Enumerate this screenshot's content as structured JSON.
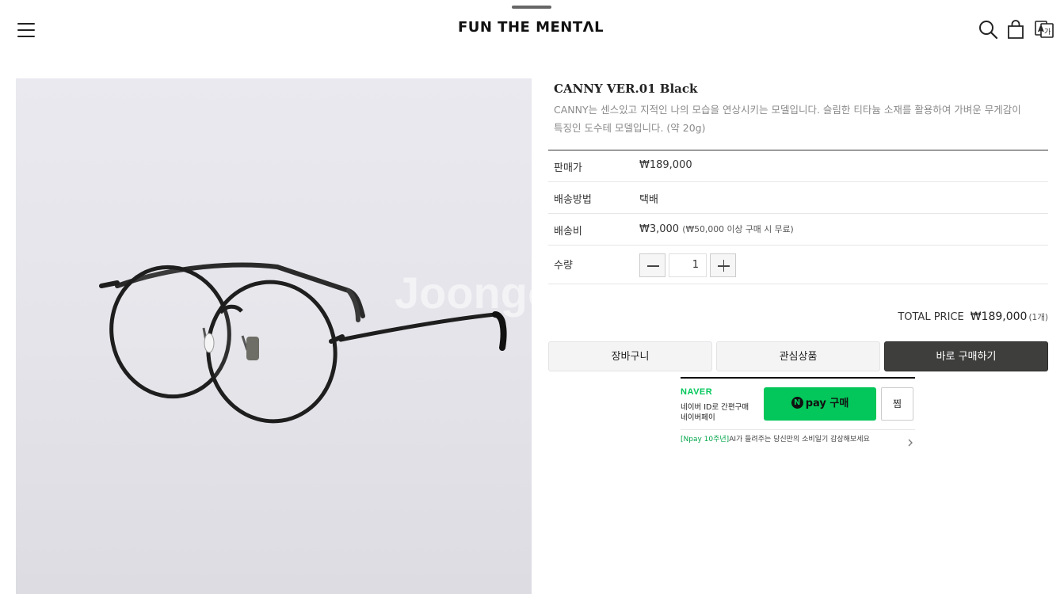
{
  "header": {
    "logo": "FUN THE MENTΛL",
    "menu_icon": "hamburger-menu-icon",
    "search_icon": "search-icon",
    "cart_icon": "shopping-bag-icon",
    "language_icon": "translate-icon"
  },
  "product_image": {
    "watermark": "Joongo"
  },
  "product": {
    "title": "CANNY VER.01 Black",
    "description": "CANNY는 센스있고 지적인 나의 모습을 연상시키는 모델입니다. 슬림한 티타늄 소재를 활용하여 가벼운 무게감이 특징인 도수테 모델입니다. (약 20g)"
  },
  "details": {
    "price_label": "판매가",
    "price_value": "₩189,000",
    "shipping_method_label": "배송방법",
    "shipping_method_value": "택배",
    "shipping_fee_label": "배송비",
    "shipping_fee_value": "₩3,000",
    "shipping_fee_note": "(₩50,000 이상 구매 시 무료)",
    "quantity_label": "수량",
    "quantity_value": "1"
  },
  "total": {
    "label": "TOTAL PRICE",
    "amount": "₩189,000",
    "count": "(1개)"
  },
  "actions": {
    "cart": "장바구니",
    "wishlist": "관심상품",
    "buy_now": "바로 구매하기"
  },
  "npay": {
    "brand": "NAVER",
    "line1": "네이버 ID로 간편구매",
    "line2": "네이버페이",
    "button_label": "pay 구매",
    "button_badge": "N",
    "zzim": "찜",
    "promo_highlight": "[Npay 10주년]",
    "promo_text": "AI가 들려주는 당신만의 소비일기 감상해보세요"
  },
  "colors": {
    "accent_dark": "#3e3f3d",
    "naver_green": "#03c75a"
  }
}
